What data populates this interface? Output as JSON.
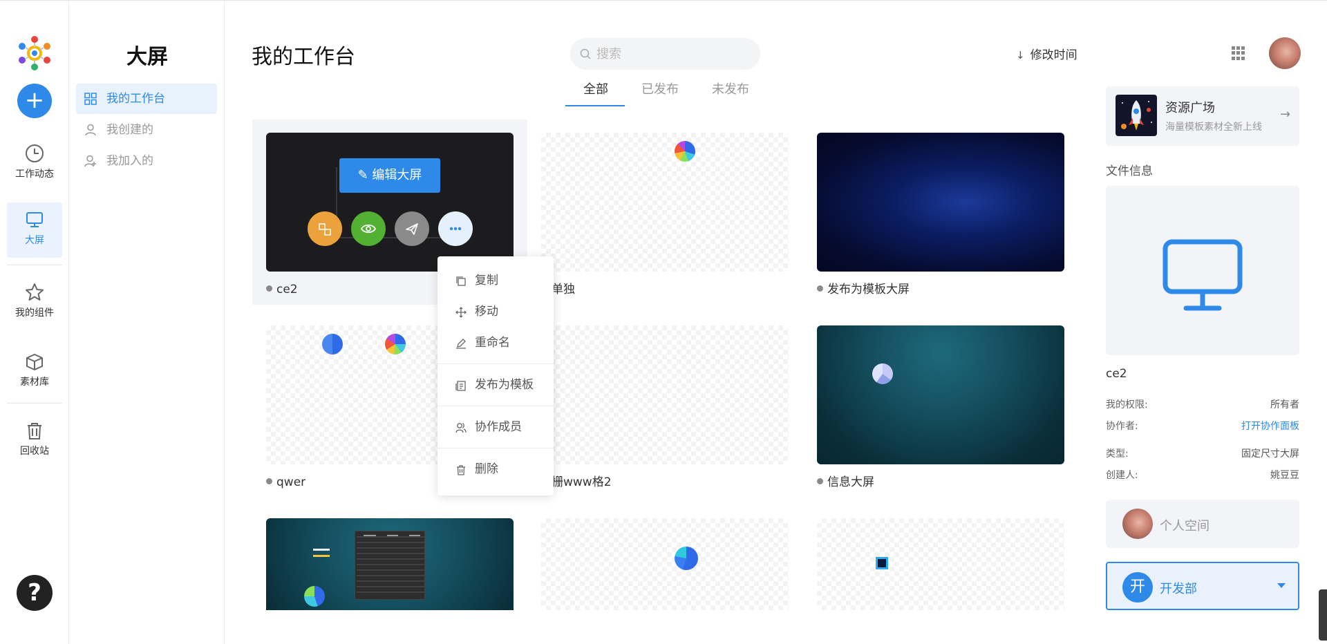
{
  "rail": {
    "items": [
      {
        "label": "工作动态",
        "icon": "clock-icon"
      },
      {
        "label": "大屏",
        "icon": "monitor-icon"
      },
      {
        "label": "我的组件",
        "icon": "star-icon"
      },
      {
        "label": "素材库",
        "icon": "box-icon"
      },
      {
        "label": "回收站",
        "icon": "trash-icon"
      }
    ],
    "help_label": "?",
    "accent": "#2f89e8"
  },
  "subnav": {
    "title": "大屏",
    "items": [
      {
        "label": "我的工作台",
        "icon": "grid-icon"
      },
      {
        "label": "我创建的",
        "icon": "user-icon"
      },
      {
        "label": "我加入的",
        "icon": "user-plus-icon"
      }
    ]
  },
  "header": {
    "title": "我的工作台",
    "search_placeholder": "搜索",
    "sort_label": "修改时间"
  },
  "tabs": [
    "全部",
    "已发布",
    "未发布"
  ],
  "cards": [
    {
      "name": "ce2",
      "thumb": "dark"
    },
    {
      "name": "单独",
      "thumb": "transparent"
    },
    {
      "name": "发布为模板大屏",
      "thumb": "space"
    },
    {
      "name": "qwer",
      "thumb": "transparent"
    },
    {
      "name": "栅www格2",
      "thumb": "transparent"
    },
    {
      "name": "信息大屏",
      "thumb": "teal"
    },
    {
      "name": "",
      "thumb": "teal"
    },
    {
      "name": "",
      "thumb": "transparent"
    },
    {
      "name": "",
      "thumb": "transparent"
    }
  ],
  "card_overlay": {
    "edit_label": "编辑大屏"
  },
  "context_menu": [
    {
      "label": "复制",
      "icon": "copy-icon"
    },
    {
      "label": "移动",
      "icon": "move-icon"
    },
    {
      "label": "重命名",
      "icon": "pencil-icon"
    },
    {
      "label": "发布为模板",
      "icon": "template-icon"
    },
    {
      "label": "协作成员",
      "icon": "members-icon"
    },
    {
      "label": "删除",
      "icon": "delete-icon"
    }
  ],
  "panel": {
    "resource": {
      "title": "资源广场",
      "subtitle": "海量模板素材全新上线"
    },
    "file_info_label": "文件信息",
    "file_name": "ce2",
    "rows": [
      {
        "key": "我的权限:",
        "value": "所有者"
      },
      {
        "key": "协作者:",
        "value": "打开协作面板"
      },
      {
        "key": "类型:",
        "value": "固定尺寸大屏"
      },
      {
        "key": "创建人:",
        "value": "姚豆豆"
      }
    ],
    "personal_space": "个人空间",
    "org": {
      "avatar_char": "开",
      "name": "开发部"
    }
  }
}
